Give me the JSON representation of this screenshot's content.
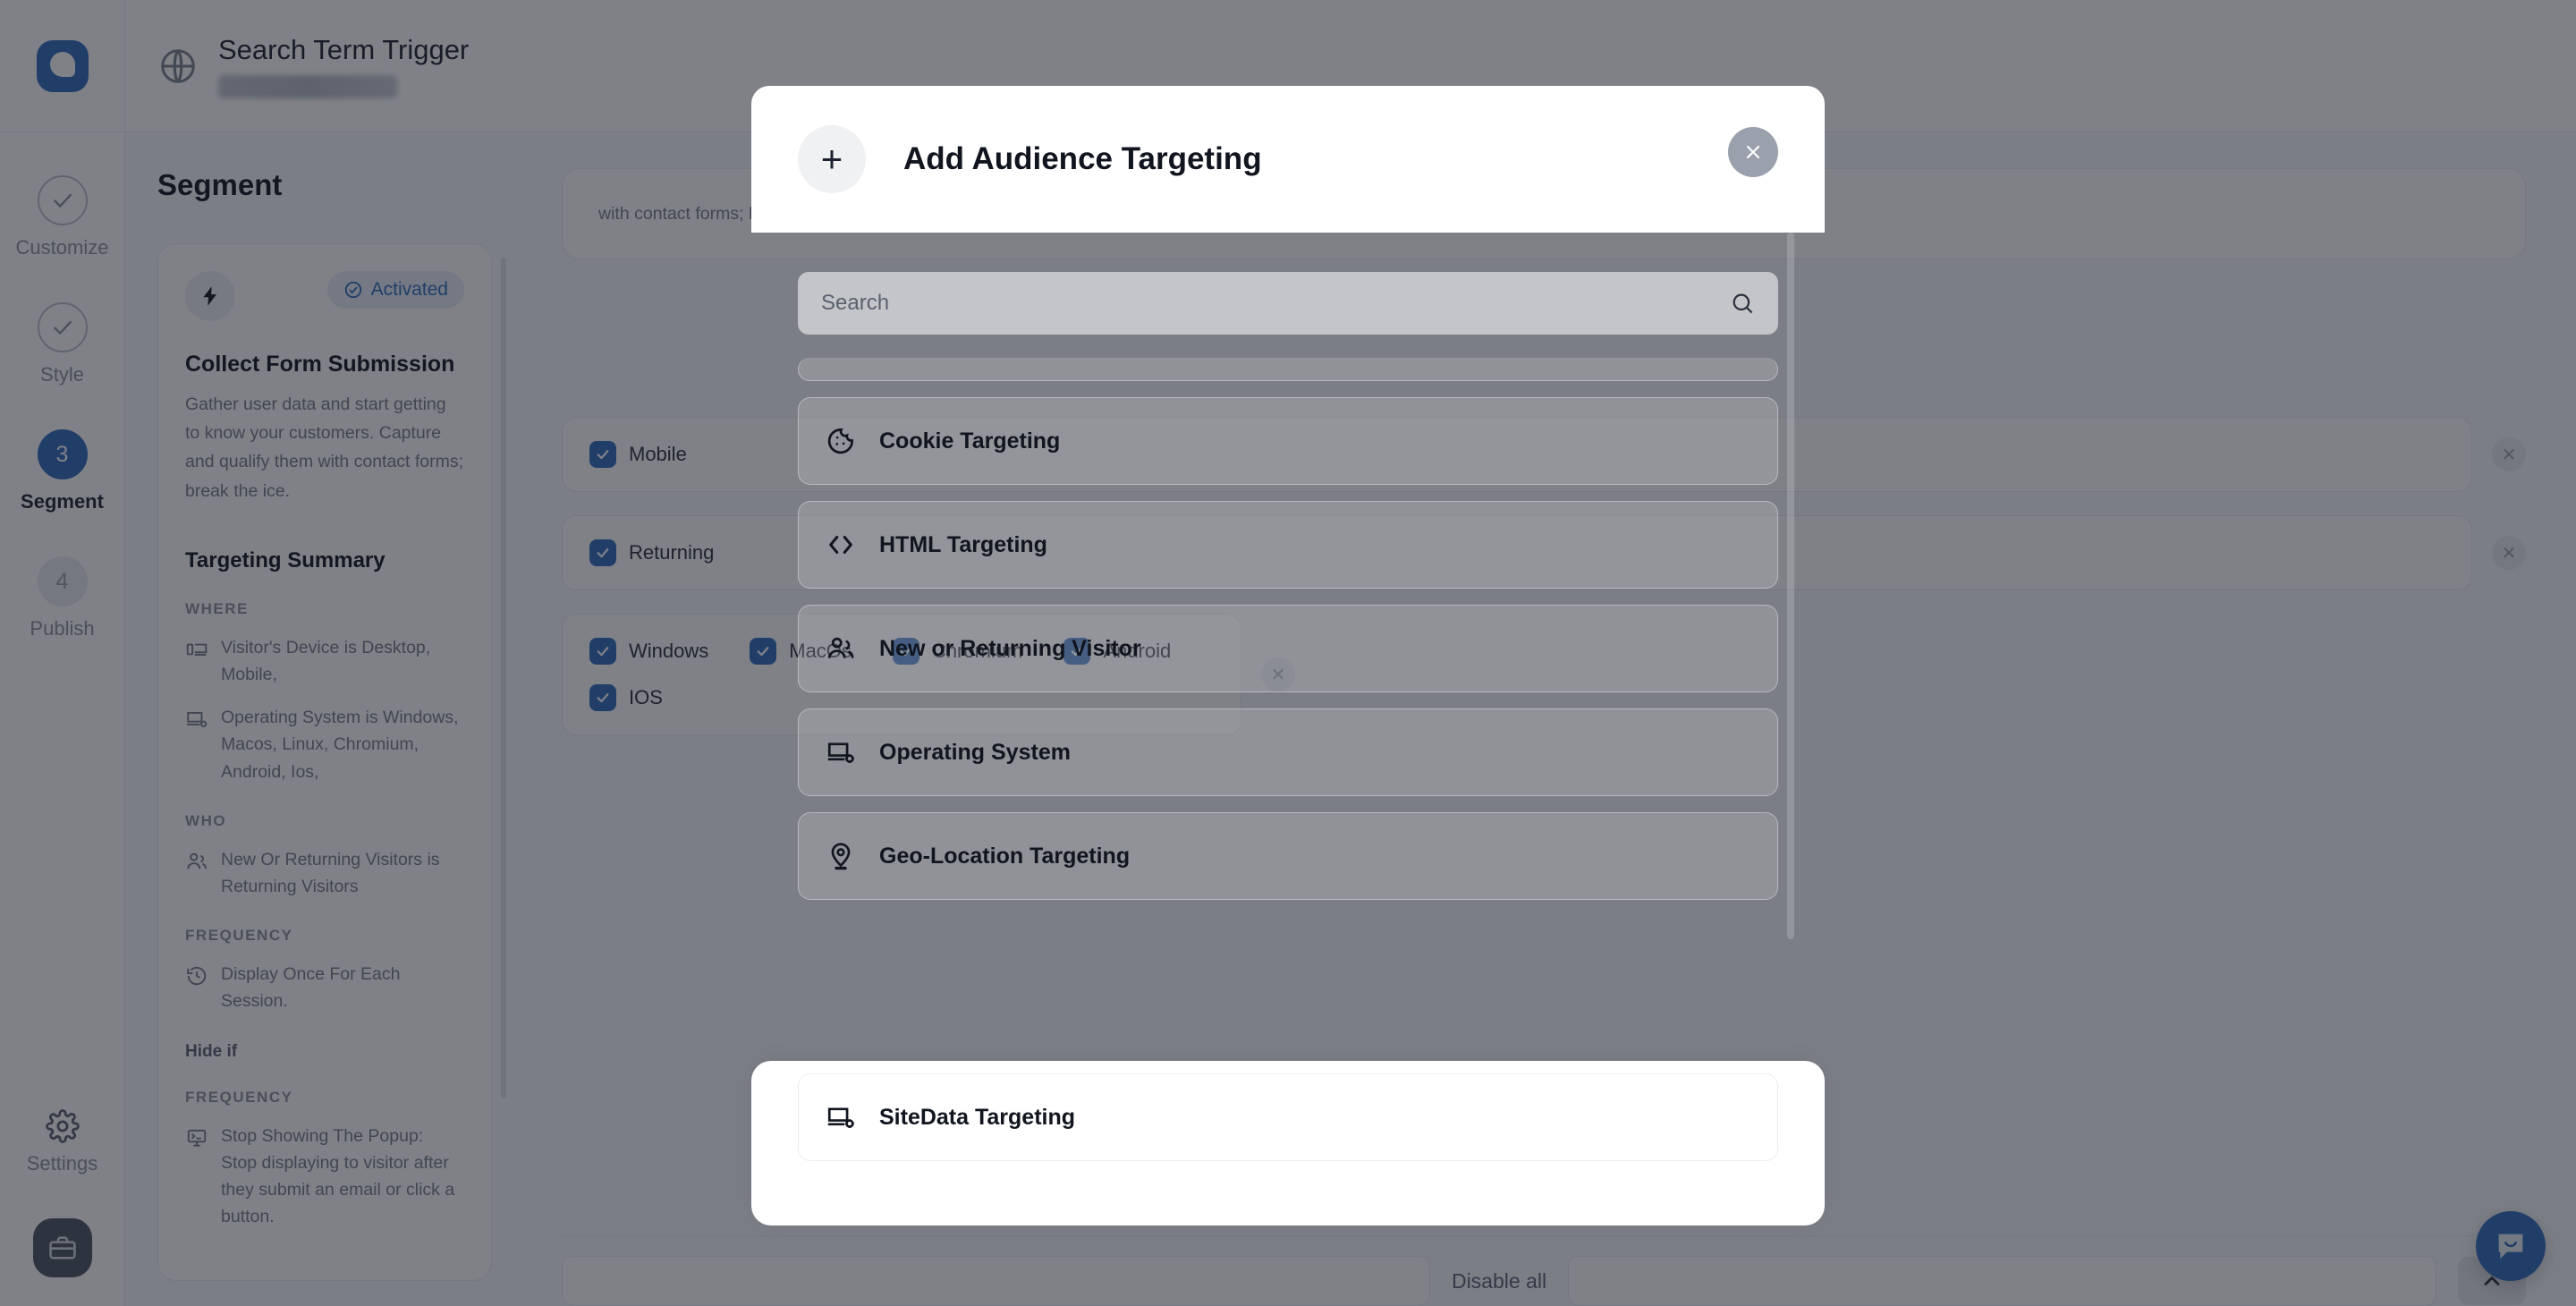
{
  "rail": {
    "logo_name": "popup-logo",
    "steps": [
      {
        "label": "Customize",
        "marker": "check",
        "state": "done"
      },
      {
        "label": "Style",
        "marker": "check",
        "state": "done"
      },
      {
        "label": "Segment",
        "marker": "3",
        "state": "active"
      },
      {
        "label": "Publish",
        "marker": "4",
        "state": "idle"
      }
    ],
    "settings_label": "Settings",
    "briefcase_icon": "briefcase-icon"
  },
  "topbar": {
    "globe_icon": "globe-icon",
    "title": "Search Term Trigger",
    "url_redacted": ""
  },
  "panel": {
    "heading": "Segment",
    "bolt_icon": "bolt-icon",
    "status_badge": "Activated",
    "card_title": "Collect Form Submission",
    "card_desc": "Gather user data and start getting to know your customers. Capture and qualify them with contact forms; break the ice.",
    "summary_title": "Targeting Summary",
    "groups": [
      {
        "kicker": "WHERE",
        "rows": [
          {
            "icon": "device-icon",
            "text": "Visitor's Device is Desktop, Mobile,"
          },
          {
            "icon": "os-icon",
            "text": "Operating System is Windows, Macos, Linux, Chromium, Android, Ios,"
          }
        ]
      },
      {
        "kicker": "WHO",
        "rows": [
          {
            "icon": "visitors-icon",
            "text": "New Or Returning Visitors is Returning Visitors"
          }
        ]
      },
      {
        "kicker": "FREQUENCY",
        "rows": [
          {
            "icon": "history-icon",
            "text": "Display Once For Each Session."
          }
        ]
      }
    ],
    "hide_if_label": "Hide if",
    "hide_kicker": "FREQUENCY",
    "hide_row": {
      "icon": "stop-popup-icon",
      "title": "Stop Showing The Popup:",
      "sub": "Stop displaying to visitor after they submit an email or click a button."
    }
  },
  "workspace": {
    "desc_tail": "with contact forms; break the ice.",
    "rules": [
      {
        "options": [
          {
            "label": "Mobile",
            "checked": true
          }
        ]
      },
      {
        "options": [
          {
            "label": "Returning",
            "checked": true
          }
        ]
      },
      {
        "options": [
          {
            "label": "Windows",
            "checked": true
          },
          {
            "label": "MacOs",
            "checked": true
          },
          {
            "label": "Chromium",
            "checked": true
          },
          {
            "label": "Android",
            "checked": true
          },
          {
            "label": "IOS",
            "checked": true
          }
        ]
      }
    ],
    "remove_icon": "close-circle-icon",
    "disable_all_label": "Disable all",
    "collapse_icon": "chevron-up-icon",
    "chat_icon": "chat-bubble-icon"
  },
  "modal": {
    "plus_icon": "plus-icon",
    "title": "Add Audience Targeting",
    "close_icon": "close-icon",
    "search": {
      "placeholder": "Search",
      "value": "",
      "icon": "search-icon"
    },
    "items": [
      {
        "label": "Cookie Targeting",
        "icon": "cookie-icon"
      },
      {
        "label": "HTML Targeting",
        "icon": "code-brackets-icon"
      },
      {
        "label": "New or Returning Visitor",
        "icon": "visitors-icon"
      },
      {
        "label": "Operating System",
        "icon": "os-icon"
      },
      {
        "label": "Geo-Location Targeting",
        "icon": "map-pin-icon"
      }
    ],
    "highlighted_item": {
      "label": "SiteData Targeting",
      "icon": "sitedata-icon"
    }
  },
  "colors": {
    "brand": "#2f6bbd",
    "scrim": "rgba(22,26,37,0.55)",
    "text": "#11151f",
    "muted": "#767c8b"
  }
}
